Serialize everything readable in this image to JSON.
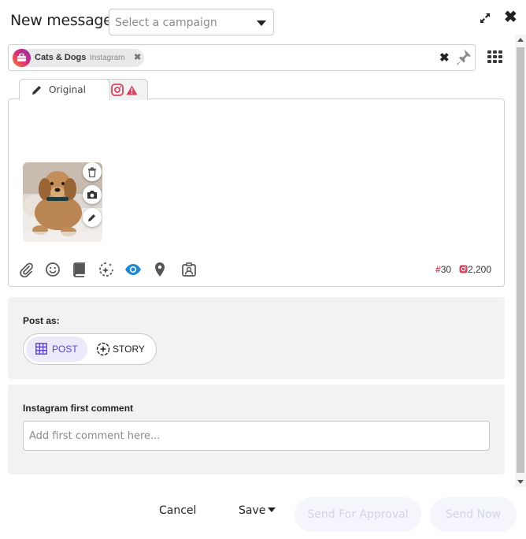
{
  "header": {
    "title": "New message",
    "campaign_placeholder": "Select a campaign"
  },
  "profiles": {
    "selected": [
      {
        "name": "Cats & Dogs",
        "network": "Instagram"
      }
    ]
  },
  "editor": {
    "tabs": [
      {
        "label": "Original",
        "icon": "pencil-icon"
      },
      {
        "label": "",
        "icon": "instagram-icon",
        "status": "warning"
      }
    ],
    "media_count": 1,
    "hashtag_count": "30",
    "char_remaining": "2,200",
    "toolbar_icons": [
      "attachment-icon",
      "emoji-icon",
      "content-library-icon",
      "ai-assist-icon",
      "preview-icon",
      "location-icon",
      "user-tag-icon"
    ]
  },
  "post_as": {
    "label": "Post as:",
    "options": [
      {
        "label": "POST",
        "selected": true
      },
      {
        "label": "STORY",
        "selected": false
      }
    ]
  },
  "first_comment": {
    "label": "Instagram first comment",
    "placeholder": "Add first comment here..."
  },
  "footer": {
    "cancel": "Cancel",
    "save": "Save",
    "send_for_approval": "Send For Approval",
    "send_now": "Send Now"
  },
  "colors": {
    "accent_purple": "#5b3fd0",
    "instagram_pink": "#d5435f",
    "preview_blue": "#1e88d0",
    "disabled_button_bg": "#f4f6fc"
  }
}
